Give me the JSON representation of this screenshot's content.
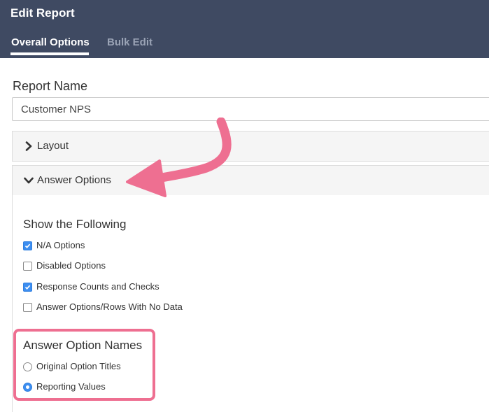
{
  "header": {
    "title": "Edit Report",
    "tabs": [
      {
        "label": "Overall Options",
        "active": true
      },
      {
        "label": "Bulk Edit",
        "active": false
      }
    ]
  },
  "form": {
    "report_name_label": "Report Name",
    "report_name_value": "Customer NPS"
  },
  "panels": {
    "layout": {
      "title": "Layout",
      "state": "collapsed",
      "icon": "chevron-right-icon"
    },
    "answer_options": {
      "title": "Answer Options",
      "state": "expanded",
      "icon": "chevron-down-icon"
    }
  },
  "show_following": {
    "title": "Show the Following",
    "options": [
      {
        "label": "N/A Options",
        "checked": true
      },
      {
        "label": "Disabled Options",
        "checked": false
      },
      {
        "label": "Response Counts and Checks",
        "checked": true
      },
      {
        "label": "Answer Options/Rows With No Data",
        "checked": false
      }
    ]
  },
  "answer_option_names": {
    "title": "Answer Option Names",
    "options": [
      {
        "label": "Original Option Titles",
        "selected": false
      },
      {
        "label": "Reporting Values",
        "selected": true
      }
    ]
  },
  "colors": {
    "header_bg": "#3f4a62",
    "accent_blue": "#3d8ef0",
    "annotation_pink": "#ee6f91"
  }
}
